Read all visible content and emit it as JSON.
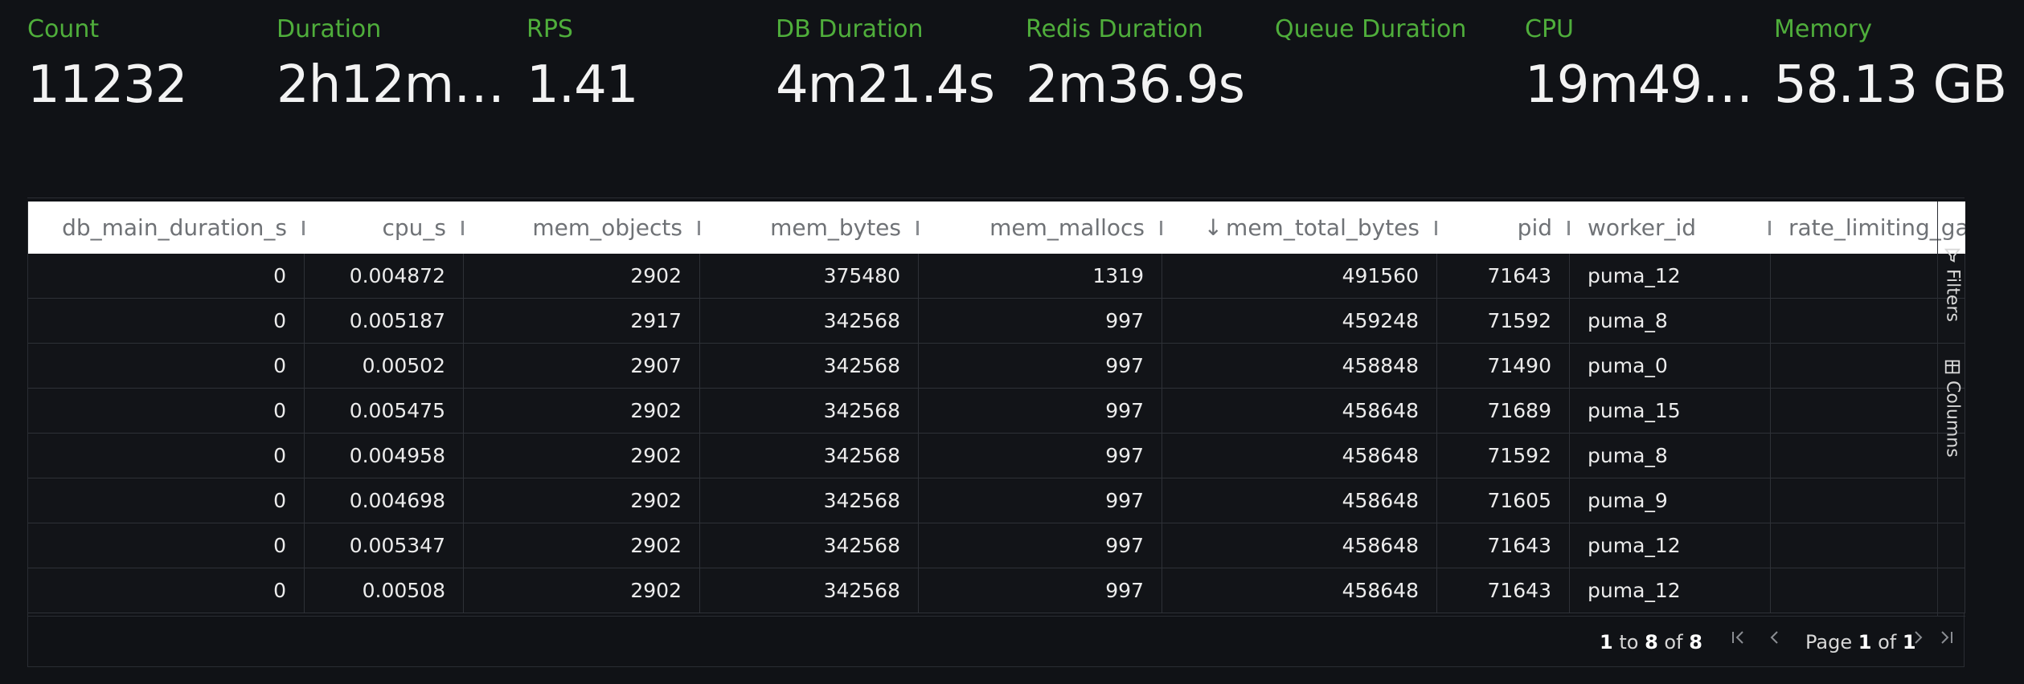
{
  "metrics": [
    {
      "label": "Count",
      "value": "11232"
    },
    {
      "label": "Duration",
      "value": "2h12m…"
    },
    {
      "label": "RPS",
      "value": "1.41"
    },
    {
      "label": "DB Duration",
      "value": "4m21.4s"
    },
    {
      "label": "Redis Duration",
      "value": "2m36.9s"
    },
    {
      "label": "Queue Duration",
      "value": ""
    },
    {
      "label": "CPU",
      "value": "19m49…"
    },
    {
      "label": "Memory",
      "value": "58.13 GB"
    }
  ],
  "table": {
    "sort_arrow": "↓",
    "columns": [
      "db_main_duration_s",
      "cpu_s",
      "mem_objects",
      "mem_bytes",
      "mem_mallocs",
      "mem_total_bytes",
      "pid",
      "worker_id",
      "rate_limiting_gat"
    ],
    "rows": [
      [
        "0",
        "0.004872",
        "2902",
        "375480",
        "1319",
        "491560",
        "71643",
        "puma_12",
        ""
      ],
      [
        "0",
        "0.005187",
        "2917",
        "342568",
        "997",
        "459248",
        "71592",
        "puma_8",
        ""
      ],
      [
        "0",
        "0.00502",
        "2907",
        "342568",
        "997",
        "458848",
        "71490",
        "puma_0",
        ""
      ],
      [
        "0",
        "0.005475",
        "2902",
        "342568",
        "997",
        "458648",
        "71689",
        "puma_15",
        ""
      ],
      [
        "0",
        "0.004958",
        "2902",
        "342568",
        "997",
        "458648",
        "71592",
        "puma_8",
        ""
      ],
      [
        "0",
        "0.004698",
        "2902",
        "342568",
        "997",
        "458648",
        "71605",
        "puma_9",
        ""
      ],
      [
        "0",
        "0.005347",
        "2902",
        "342568",
        "997",
        "458648",
        "71643",
        "puma_12",
        ""
      ],
      [
        "0",
        "0.00508",
        "2902",
        "342568",
        "997",
        "458648",
        "71643",
        "puma_12",
        ""
      ]
    ]
  },
  "side_panel": {
    "filters": "Filters",
    "columns": "Columns"
  },
  "pagination": {
    "from": "1",
    "to_word": "to",
    "to": "8",
    "of_word": "of",
    "total": "8",
    "page_word": "Page",
    "page": "1",
    "page_of": "of",
    "page_total": "1"
  },
  "colors": {
    "label": "#4fae3b",
    "background": "#101216",
    "header": "#ffffff"
  }
}
